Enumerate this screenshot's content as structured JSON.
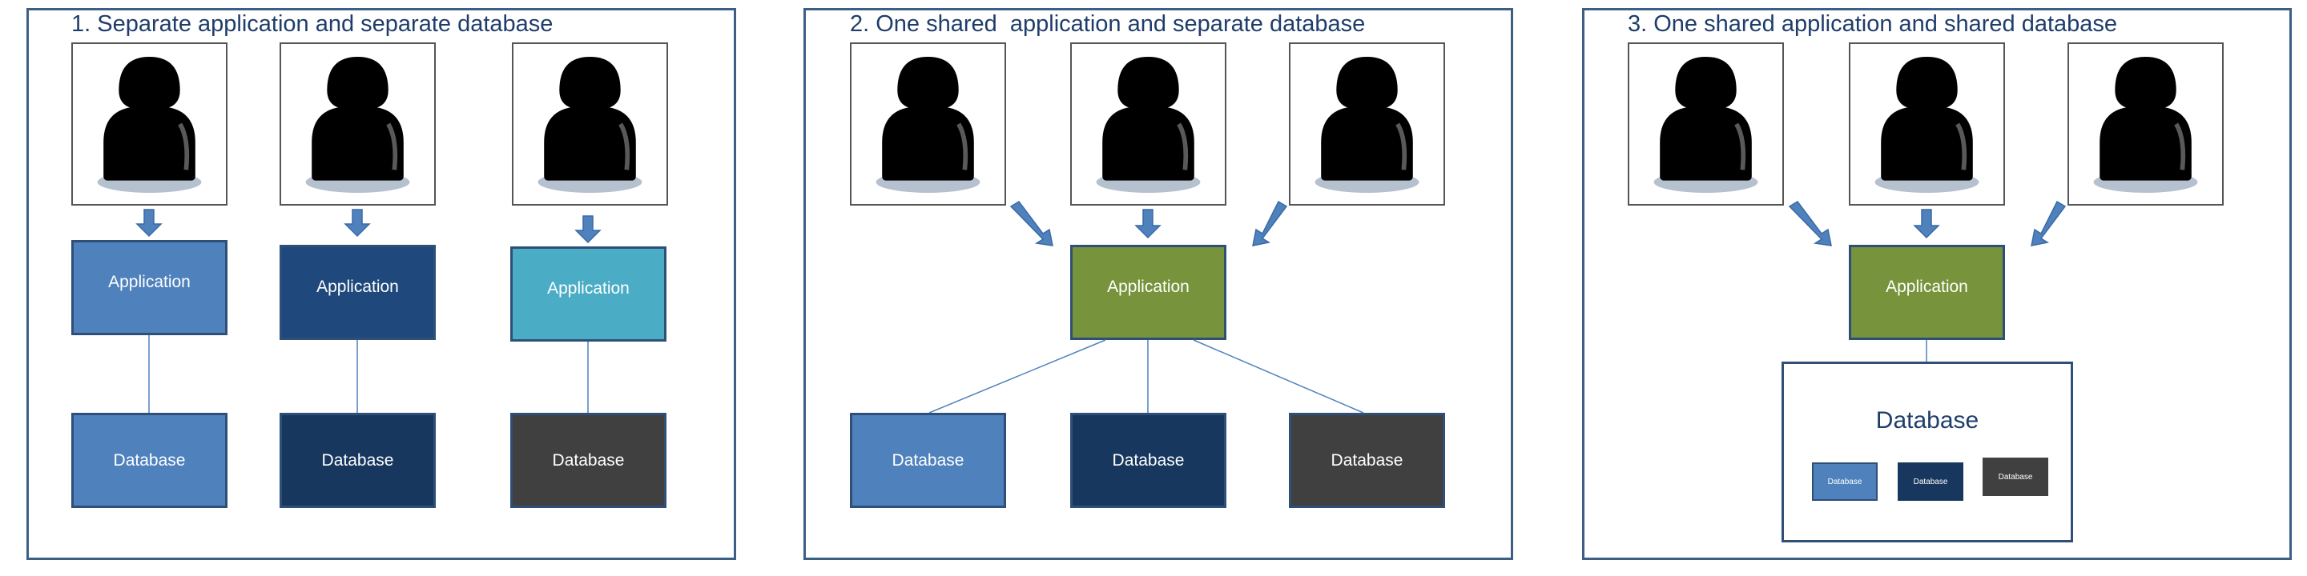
{
  "colors": {
    "frame": "#3d5f86",
    "title": "#1f3d6b",
    "arrow": "#4f81bd",
    "blue": "#4f81bd",
    "navy": "#1f497d",
    "darknavy": "#17375e",
    "teal": "#4bacc6",
    "gray": "#404040",
    "green": "#77933c"
  },
  "panels": [
    {
      "title": "1. Separate application and separate database",
      "users": [
        "red-user-icon",
        "teal-user-icon",
        "green-user-icon"
      ],
      "applications": [
        "Application",
        "Application",
        "Application"
      ],
      "databases": [
        "Database",
        "Database",
        "Database"
      ]
    },
    {
      "title": "2. One shared  application and separate database",
      "users": [
        "red-user-icon",
        "teal-user-icon",
        "green-user-icon"
      ],
      "application": "Application",
      "databases": [
        "Database",
        "Database",
        "Database"
      ]
    },
    {
      "title": "3. One shared application and shared database",
      "users": [
        "red-user-icon",
        "teal-user-icon",
        "green-user-icon"
      ],
      "application": "Application",
      "database_container": "Database",
      "databases": [
        "Database",
        "Database",
        "Database"
      ]
    }
  ]
}
